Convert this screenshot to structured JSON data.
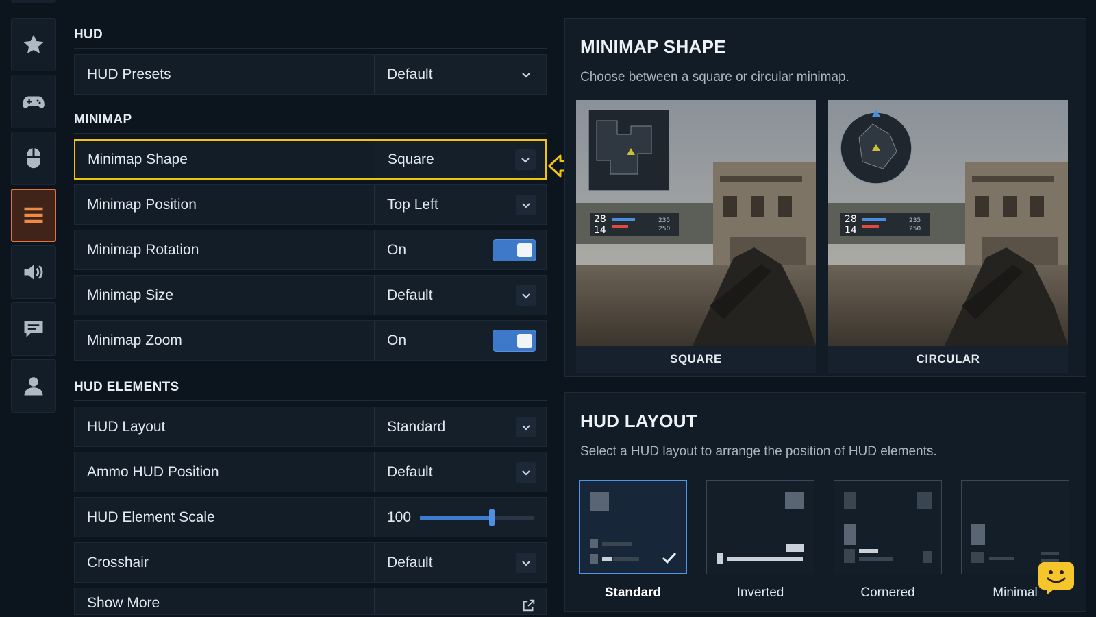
{
  "nav": {
    "items": [
      {
        "icon": "star-icon",
        "active": false
      },
      {
        "icon": "gamepad-icon",
        "active": false
      },
      {
        "icon": "mouse-icon",
        "active": false
      },
      {
        "icon": "menu-icon",
        "active": true
      },
      {
        "icon": "speaker-icon",
        "active": false
      },
      {
        "icon": "chat-icon",
        "active": false
      },
      {
        "icon": "user-icon",
        "active": false
      }
    ]
  },
  "sections": {
    "hud": {
      "title": "HUD",
      "presets": {
        "label": "HUD Presets",
        "value": "Default"
      }
    },
    "minimap": {
      "title": "MINIMAP",
      "shape": {
        "label": "Minimap Shape",
        "value": "Square"
      },
      "position": {
        "label": "Minimap Position",
        "value": "Top Left"
      },
      "rotation": {
        "label": "Minimap Rotation",
        "value": "On"
      },
      "size": {
        "label": "Minimap Size",
        "value": "Default"
      },
      "zoom": {
        "label": "Minimap Zoom",
        "value": "On"
      }
    },
    "hud_elements": {
      "title": "HUD ELEMENTS",
      "layout": {
        "label": "HUD Layout",
        "value": "Standard"
      },
      "ammo_position": {
        "label": "Ammo HUD Position",
        "value": "Default"
      },
      "element_scale": {
        "label": "HUD Element Scale",
        "value": "100",
        "fill_fraction": 0.63
      },
      "crosshair": {
        "label": "Crosshair",
        "value": "Default"
      },
      "show_more": {
        "label": "Show More"
      }
    }
  },
  "minimap_panel": {
    "title": "MINIMAP SHAPE",
    "description": "Choose between a square or circular minimap.",
    "options": [
      {
        "caption": "SQUARE",
        "hud_top": "28",
        "hud_bottom": "14",
        "hud_right_top": "235",
        "hud_right_bottom": "250"
      },
      {
        "caption": "CIRCULAR",
        "hud_top": "28",
        "hud_bottom": "14",
        "hud_right_top": "235",
        "hud_right_bottom": "250"
      }
    ]
  },
  "layout_panel": {
    "title": "HUD LAYOUT",
    "description": "Select a HUD layout to arrange the position of HUD elements.",
    "options": [
      {
        "label": "Standard",
        "selected": true
      },
      {
        "label": "Inverted",
        "selected": false
      },
      {
        "label": "Cornered",
        "selected": false
      },
      {
        "label": "Minimal",
        "selected": false
      }
    ]
  },
  "colors": {
    "accent_orange": "#e0743a",
    "selection_yellow": "#f1c40f",
    "toggle_blue": "#3e78c9",
    "layout_selected_blue": "#4f95e8"
  }
}
